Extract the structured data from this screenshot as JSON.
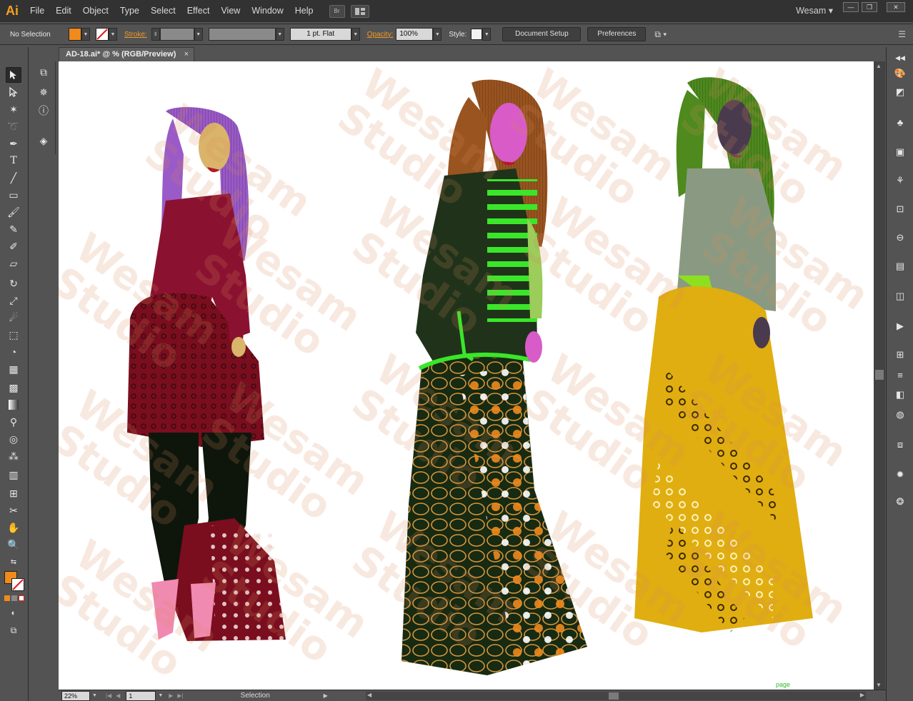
{
  "app": {
    "logo": "Ai",
    "menu": [
      "File",
      "Edit",
      "Object",
      "Type",
      "Select",
      "Effect",
      "View",
      "Window",
      "Help"
    ],
    "bridge_label": "Br",
    "user": "Wesam ▾"
  },
  "control_bar": {
    "selection_status": "No Selection",
    "stroke_label": "Stroke:",
    "stroke_profile": "1 pt. Flat",
    "opacity_label": "Opacity:",
    "opacity_value": "100%",
    "style_label": "Style:",
    "document_setup": "Document Setup",
    "preferences": "Preferences",
    "fill_color": "#f08a1c",
    "accent_color": "#f49a23"
  },
  "document": {
    "tab_title": "AD-18.ai* @ % (RGB/Preview)",
    "tab_close": "×",
    "artboard_label": "page",
    "watermark_line1": "Wesam",
    "watermark_line2": "Studio"
  },
  "status_bar": {
    "zoom": "22%",
    "artboard_number": "1",
    "current_tool": "Selection"
  },
  "tools": [
    "selection-tool-icon",
    "direct-selection-tool-icon",
    "magic-wand-tool-icon",
    "lasso-tool-icon",
    "pen-tool-icon",
    "type-tool-icon",
    "line-tool-icon",
    "rectangle-tool-icon",
    "paintbrush-tool-icon",
    "pencil-tool-icon",
    "blob-brush-tool-icon",
    "eraser-tool-icon",
    "rotate-tool-icon",
    "scale-tool-icon",
    "warp-tool-icon",
    "free-transform-tool-icon",
    "shape-builder-tool-icon",
    "perspective-grid-tool-icon",
    "mesh-tool-icon",
    "gradient-tool-icon",
    "eyedropper-tool-icon",
    "blend-tool-icon",
    "symbol-sprayer-tool-icon",
    "column-graph-tool-icon",
    "artboard-tool-icon",
    "slice-tool-icon",
    "hand-tool-icon",
    "zoom-tool-icon"
  ]
}
